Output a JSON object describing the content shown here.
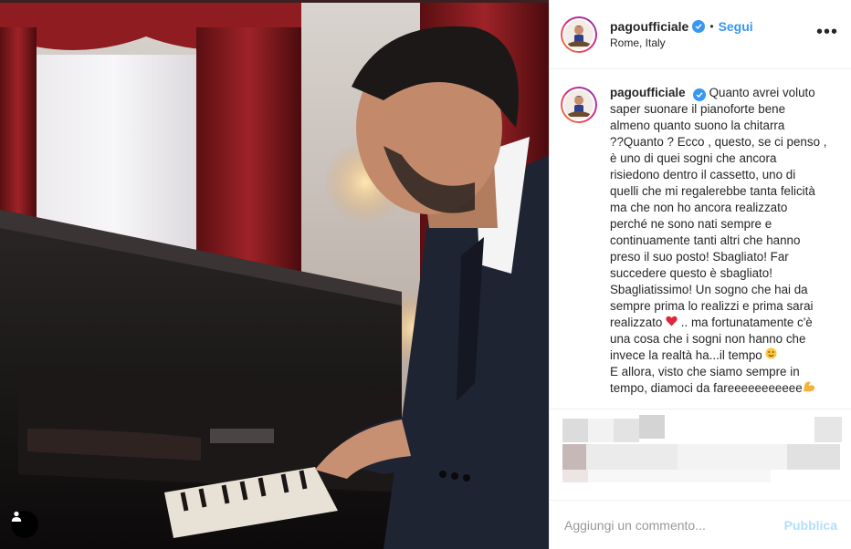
{
  "post": {
    "username": "pagoufficiale",
    "location": "Rome, Italy",
    "follow_label": "Segui",
    "separator": "•",
    "more_label": "•••",
    "caption_lines": [
      "saper suonare il pianoforte bene",
      "almeno quanto suono la chitarra",
      "??Quanto ? Ecco , questo, se ci penso ,",
      "è uno di quei sogni che ancora",
      "risiedono dentro il cassetto, uno di",
      "quelli che mi regalerebbe tanta felicità",
      "ma che non ho ancora realizzato",
      "perché ne sono nati sempre e",
      "continuamente tanti altri che hanno",
      "preso il suo posto! Sbagliato! Far",
      "succedere questo è sbagliato!",
      "Sbagliatissimo! Un sogno che hai da",
      "sempre prima lo realizzi e prima sarai"
    ],
    "caption_first_line": "Quanto avrei voluto",
    "caption_heart_before": "realizzato",
    "caption_heart_after": ".. ma fortunatamente c'è",
    "caption_line_a": "una cosa che i sogni non hanno che",
    "caption_wink_before": "invece la realtà ha...il tempo",
    "caption_line_b": "E allora, visto che siamo sempre in",
    "caption_muscle_before": "tempo, diamoci da fareeeeeeeeeee"
  },
  "comment": {
    "placeholder": "Aggiungi un commento...",
    "publish_label": "Pubblica"
  },
  "colors": {
    "accent": "#3897f0",
    "publish_disabled": "#b2dffc",
    "heart": "#ed4956"
  },
  "icons": [
    "verified-badge-icon",
    "more-options-icon",
    "user-tag-icon",
    "heart-emoji",
    "wink-emoji",
    "flexed-biceps-emoji"
  ]
}
